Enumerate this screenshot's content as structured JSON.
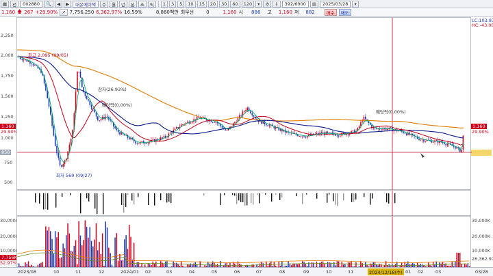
{
  "toolbar": {
    "grid_icon": "▦",
    "code_type": "전",
    "code": "002880",
    "name": "대유에이텍",
    "periods": [
      "주",
      "월",
      "년",
      "분",
      "초",
      "틱"
    ],
    "intervals": [
      "1",
      "3",
      "5",
      "10",
      "15",
      "20",
      "30",
      "60",
      "120"
    ],
    "position": "392/6000",
    "date": "2025/03/28"
  },
  "quote": {
    "price": "1,160",
    "change": "267",
    "change_pct": "+29.90%",
    "volume": "7,756,250",
    "volume_pct": "6,362.97%",
    "turnover_pct": "16.59%",
    "amount": "8,860백만",
    "bid_label": "최우선",
    "bid_qty": "0",
    "last": "1,160",
    "high_label": "시",
    "high": "886",
    "low_label": "고",
    "low": "1,160",
    "close_label": "저",
    "close": "882",
    "buy_button": "매수",
    "sell_button": "매도"
  },
  "price_axis": {
    "ticks": [
      "2,250",
      "2,000",
      "1,750",
      "1,500",
      "1,250",
      "1,000",
      "750",
      "500"
    ],
    "right_header": "LC:103.87",
    "right_header2": "HC:-43.00",
    "current_tag": "1,160",
    "current_pct": "29.90%",
    "ref_tag": "858",
    "ref_right": "858"
  },
  "annotations": {
    "high": "최고 2,095 (09/05)",
    "low": "최저 569 (09/27)",
    "capital_reduction": "감자(26.93%)",
    "dividend_1": "배당락(0.00%)",
    "dividend_2": "배당락(0.00%)"
  },
  "volume_axis": {
    "ticks_left": [
      "30,000K",
      "20,000K",
      "10,000K"
    ],
    "ticks_right": [
      "30,000K",
      "20,000K",
      "10,000K"
    ],
    "current_tag": "7,756K",
    "current_pct": "52.97%",
    "right_value": "26,362.97%"
  },
  "xaxis": {
    "labels": [
      "2023/08",
      "10",
      "11",
      "12",
      "2024/01",
      "02",
      "03",
      "04",
      "05",
      "06",
      "07",
      "08",
      "09",
      "10",
      "11",
      "2024/12/18(수)",
      "01",
      "02",
      "03",
      "03/28"
    ],
    "cursor_label": "2024/12/18(수)"
  },
  "colors": {
    "up": "#d0021b",
    "down": "#1c39bb",
    "ma5": "#00a86b",
    "ma20": "#c0001a",
    "ma60": "#0a1a8c",
    "ma120": "#e07b00"
  }
}
